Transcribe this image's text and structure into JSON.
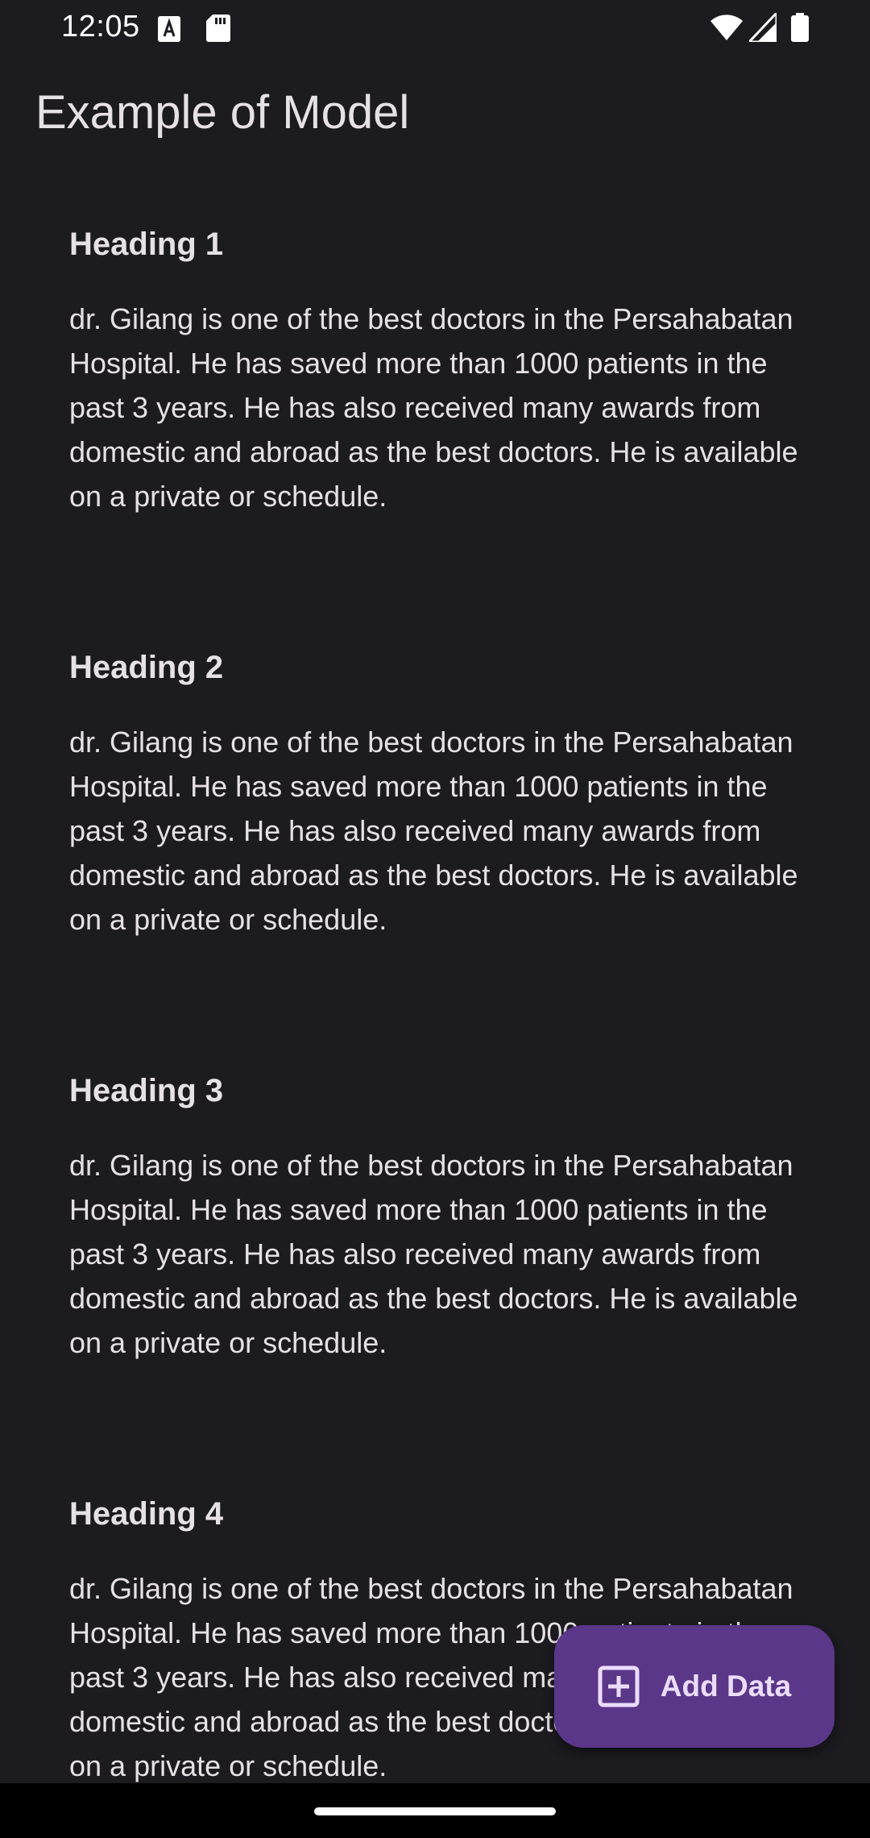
{
  "status_bar": {
    "time": "12:05",
    "left_icons": [
      "font-a-icon",
      "sd-card-icon"
    ],
    "right_icons": [
      "wifi-icon",
      "cell-signal-icon",
      "battery-icon"
    ]
  },
  "app_bar": {
    "title": "Example of Model"
  },
  "items": [
    {
      "heading": "Heading 1",
      "body": "dr. Gilang is one of the best doctors in the Persahabatan Hospital. He has saved more than 1000 patients in the past 3 years. He has also received many awards from domestic and abroad as the best doctors. He is available on a private or schedule."
    },
    {
      "heading": "Heading 2",
      "body": "dr. Gilang is one of the best doctors in the Persahabatan Hospital. He has saved more than 1000 patients in the past 3 years. He has also received many awards from domestic and abroad as the best doctors. He is available on a private or schedule."
    },
    {
      "heading": "Heading 3",
      "body": "dr. Gilang is one of the best doctors in the Persahabatan Hospital. He has saved more than 1000 patients in the past 3 years. He has also received many awards from domestic and abroad as the best doctors. He is available on a private or schedule."
    },
    {
      "heading": "Heading 4",
      "body": "dr. Gilang is one of the best doctors in the Persahabatan Hospital. He has saved more than 1000 patients in the past 3 years. He has also received many awards from domestic and abroad as the best doctors. He is available on a private or schedule."
    }
  ],
  "fab": {
    "label": "Add Data",
    "icon": "add-box-icon"
  },
  "colors": {
    "background": "#1c1b20",
    "text": "#e6e1e6",
    "fab_background": "#5a3788",
    "fab_foreground": "#ecdcff"
  }
}
